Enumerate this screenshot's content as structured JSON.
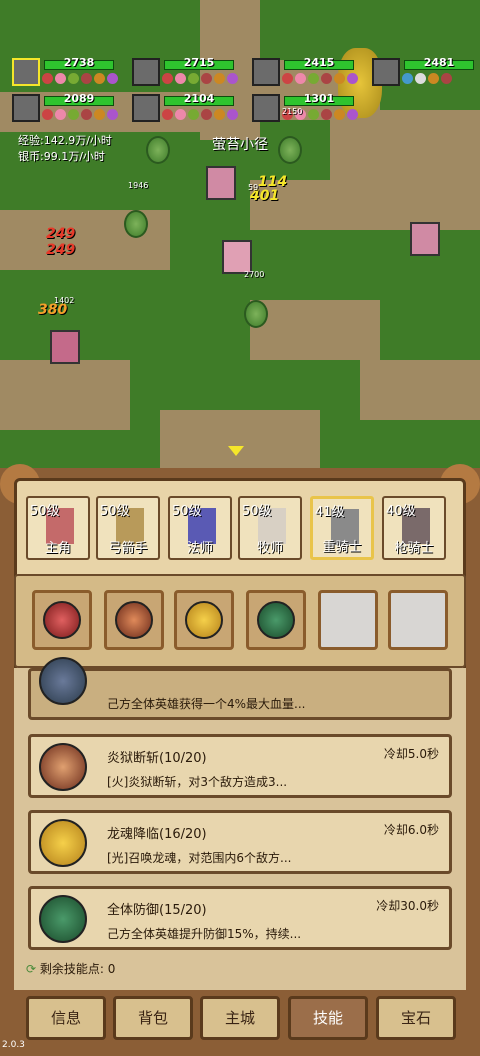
{
  "party": [
    {
      "hp": "2738",
      "selected": true
    },
    {
      "hp": "2715",
      "selected": false
    },
    {
      "hp": "2415",
      "selected": false
    },
    {
      "hp": "2481",
      "selected": false
    },
    {
      "hp": "2089",
      "selected": false
    },
    {
      "hp": "2104",
      "selected": false
    },
    {
      "hp": "1301",
      "selected": false
    }
  ],
  "rates": {
    "exp": "经验:142.9万/小时",
    "silver": "银币:99.1万/小时"
  },
  "location": "萤苔小径",
  "damage": [
    "114",
    "401",
    "249",
    "249",
    "380"
  ],
  "enemy_hp": [
    "1946",
    "59",
    "2700",
    "1402",
    "2150"
  ],
  "heroes": [
    {
      "level": "50级",
      "name": "主角"
    },
    {
      "level": "50级",
      "name": "弓箭手"
    },
    {
      "level": "50级",
      "name": "法师"
    },
    {
      "level": "50级",
      "name": "牧师"
    },
    {
      "level": "41级",
      "name": "重骑士",
      "active": true
    },
    {
      "level": "40级",
      "name": "枪骑士"
    }
  ],
  "skills": [
    {
      "name": "",
      "cd": "",
      "desc": "己方全体英雄获得一个4%最大血量..."
    },
    {
      "name": "炎狱断斩(10/20)",
      "cd": "冷却5.0秒",
      "desc": "[火]炎狱断斩，对3个敌方造成3..."
    },
    {
      "name": "龙魂降临(16/20)",
      "cd": "冷却6.0秒",
      "desc": "[光]召唤龙魂，对范围内6个敌方..."
    },
    {
      "name": "全体防御(15/20)",
      "cd": "冷却30.0秒",
      "desc": "己方全体英雄提升防御15%，持续..."
    }
  ],
  "remaining_points": "剩余技能点:  0",
  "nav": [
    "信息",
    "背包",
    "主城",
    "技能",
    "宝石"
  ],
  "version": "2.0.3"
}
